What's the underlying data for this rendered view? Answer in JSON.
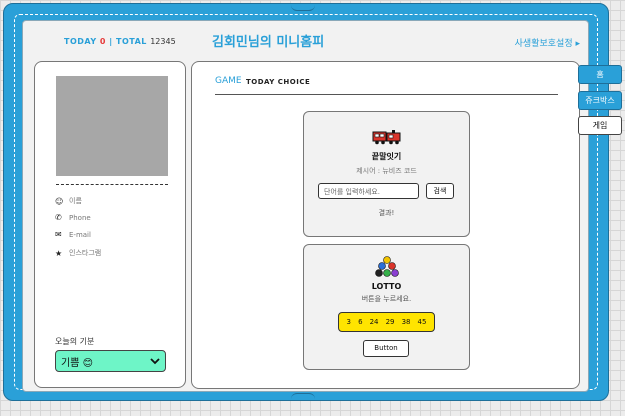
{
  "counter": {
    "today_label": "TODAY",
    "today_value": "0",
    "total_label": "TOTAL",
    "total_value": "12345"
  },
  "header": {
    "title": "김회민님의 미니홈피",
    "privacy_link": "사생활보호설정 ▸"
  },
  "profile": {
    "info": [
      {
        "icon": "smiley-icon",
        "glyph": "☺",
        "label": "이름"
      },
      {
        "icon": "phone-icon",
        "glyph": "✆",
        "label": "Phone"
      },
      {
        "icon": "mail-icon",
        "glyph": "✉",
        "label": "E-mail"
      },
      {
        "icon": "star-icon",
        "glyph": "★",
        "label": "인스타그램"
      }
    ],
    "mood_label": "오늘의 기분",
    "mood_value": "기쁨 😊"
  },
  "main": {
    "title": "GAME",
    "subtitle": "TODAY CHOICE",
    "word_game": {
      "icon": "train-icon",
      "title": "끝말잇기",
      "hint": "제시어 : 뉴비즈 코드",
      "input_placeholder": "단어를 입력하세요.",
      "search_label": "검색",
      "result_label": "결과!"
    },
    "lotto": {
      "icon": "lottery-balls-icon",
      "title": "LOTTO",
      "prompt": "버튼을 누르세요.",
      "numbers": [
        "3",
        "6",
        "24",
        "29",
        "38",
        "45"
      ],
      "button_label": "Button"
    }
  },
  "tabs": [
    {
      "label": "홈",
      "active": true
    },
    {
      "label": "쥬크박스",
      "active": true
    },
    {
      "label": "게임",
      "active": false
    }
  ],
  "colors": {
    "accent": "#2aa0d8",
    "mood": "#6ef5c7",
    "lotto": "#ffe400",
    "photo": "#a7a7a7"
  }
}
